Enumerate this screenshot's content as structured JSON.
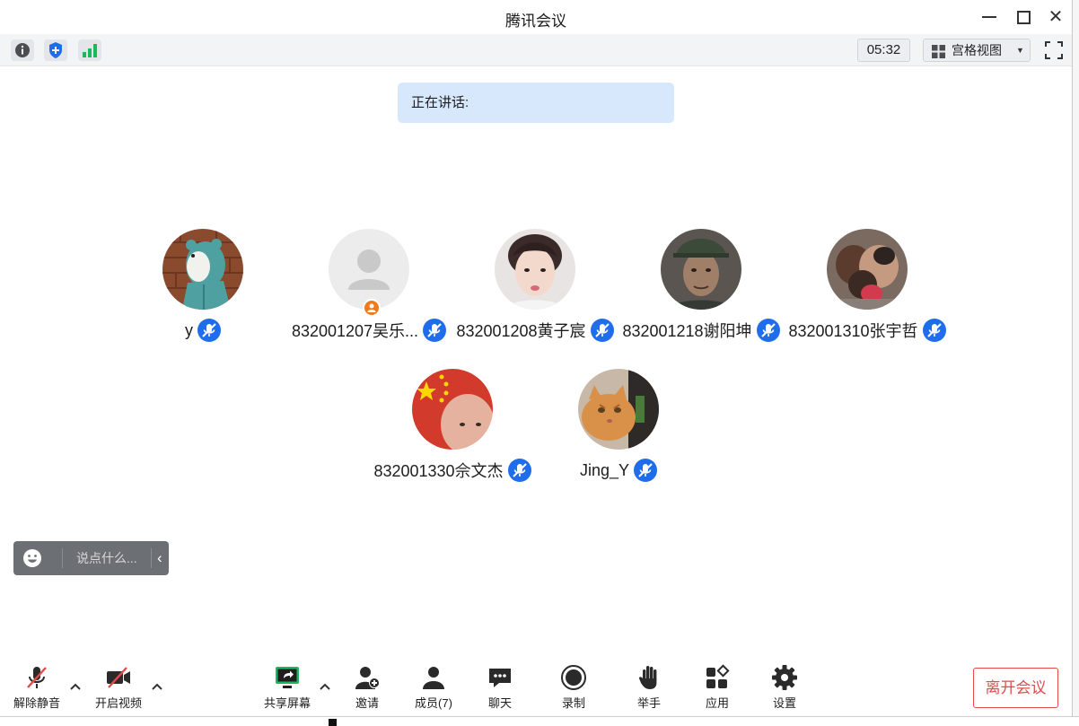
{
  "window": {
    "title": "腾讯会议"
  },
  "infobar": {
    "timer": "05:32",
    "view_label": "宫格视图"
  },
  "speaking": {
    "label": "正在讲话:"
  },
  "participants": [
    {
      "name": "y",
      "avatar": "bear-hoodie"
    },
    {
      "name": "832001207吴乐...",
      "avatar": "default-person"
    },
    {
      "name": "832001208黄子宸",
      "avatar": "young-man"
    },
    {
      "name": "832001218谢阳坤",
      "avatar": "older-man-cap"
    },
    {
      "name": "832001310张宇哲",
      "avatar": "family-hug"
    },
    {
      "name": "832001330佘文杰",
      "avatar": "flag-portrait"
    },
    {
      "name": "Jing_Y",
      "avatar": "cat"
    }
  ],
  "chat": {
    "placeholder": "说点什么..."
  },
  "toolbar": {
    "unmute": "解除静音",
    "start_video": "开启视频",
    "share_screen": "共享屏幕",
    "invite": "邀请",
    "members": "成员(7)",
    "chat": "聊天",
    "record": "录制",
    "raise_hand": "举手",
    "apps": "应用",
    "settings": "设置",
    "leave": "离开会议"
  },
  "colors": {
    "accent": "#1f6dea",
    "leave": "#e34b4b",
    "speaking_bg": "#d8e8fc"
  }
}
